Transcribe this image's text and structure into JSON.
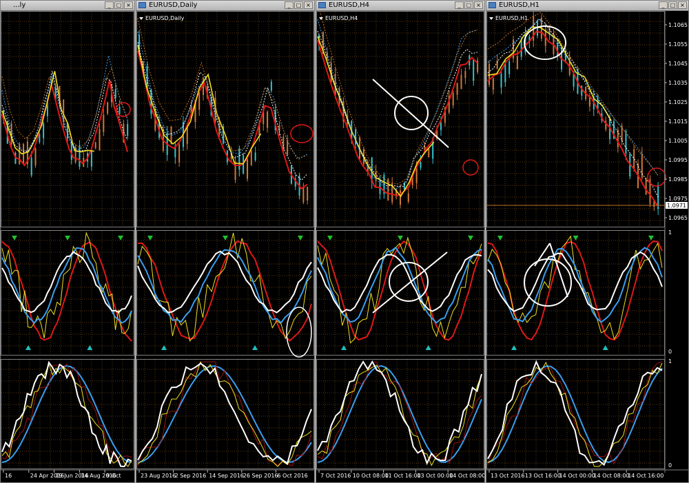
{
  "colors": {
    "background": "#000000",
    "grid": "#5a3a14",
    "bull_candle": "#33c6d0",
    "bear_candle": "#d07838",
    "red_line": "#e01818",
    "yellow_line": "#f0e020",
    "blue_line": "#3a9ff0",
    "white_line": "#ffffff",
    "dark_red_line": "#a01010",
    "annotation_red": "#e01818",
    "annotation_white": "#ffffff",
    "up_arrow": "#20c030",
    "down_arrow": "#20c0c0"
  },
  "windows": [
    {
      "title": "...ly",
      "chart_label": "",
      "price_labels": [],
      "indicator_labels": [],
      "dates": [
        "16",
        "24 Apr 2016",
        "19 Jun 2016",
        "14 Aug 2016",
        "9 Oct"
      ]
    },
    {
      "title": "EURUSD,Daily",
      "chart_label": "EURUSD,Daily",
      "price_labels": [],
      "indicator_labels": [],
      "dates": [
        "23 Aug 2016",
        "2 Sep 2016",
        "14 Sep 2016",
        "26 Sep 2016",
        "6 Oct 2016"
      ]
    },
    {
      "title": "EURUSD,H4",
      "chart_label": "EURUSD,H4",
      "price_labels": [],
      "indicator_labels": [],
      "dates": [
        "7 Oct 2016",
        "10 Oct 08:00",
        "11 Oct 16:00",
        "13 Oct 00:00",
        "14 Oct 08:00"
      ]
    },
    {
      "title": "EURUSD,H1",
      "chart_label": "EURUSD,H1",
      "price_labels": [
        "1.1065",
        "1.1055",
        "1.1045",
        "1.1035",
        "1.1025",
        "1.1015",
        "1.1005",
        "1.0995",
        "1.0985",
        "1.0975",
        "1.0965"
      ],
      "current_price": "1.0971",
      "indicator_labels": [
        "1",
        "0",
        "1",
        "0"
      ],
      "dates": [
        "13 Oct 2016",
        "13 Oct 16:00",
        "14 Oct 00:00",
        "14 Oct 08:00",
        "14 Oct 16:00"
      ]
    }
  ]
}
